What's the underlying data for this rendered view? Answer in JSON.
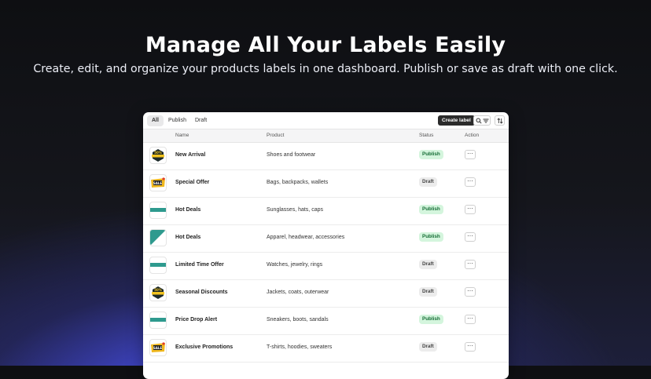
{
  "hero": {
    "title": "Manage All Your Labels Easily",
    "subtitle": "Create, edit, and organize your products labels in one dashboard. Publish or save as draft with one click."
  },
  "tabs": [
    {
      "label": "All",
      "active": true
    },
    {
      "label": "Publish",
      "active": false
    },
    {
      "label": "Draft",
      "active": false
    }
  ],
  "toolbar": {
    "create_label": "Create label",
    "search_filter_icon": "search-filter-icon",
    "sort_icon": "sort-icon"
  },
  "columns": {
    "name": "Name",
    "product": "Product",
    "status": "Status",
    "action": "Action"
  },
  "rows": [
    {
      "thumb": "badge-50-off",
      "name": "New Arrival",
      "product": "Shoes and footwear",
      "status": "Publish"
    },
    {
      "thumb": "sale-tag",
      "name": "Special Offer",
      "product": "Bags, backpacks, wallets",
      "status": "Draft"
    },
    {
      "thumb": "teal-bar",
      "name": "Hot Deals",
      "product": "Sunglasses, hats, caps",
      "status": "Publish"
    },
    {
      "thumb": "teal-corner",
      "name": "Hot Deals",
      "product": "Apparel, headwear, accessories",
      "status": "Publish"
    },
    {
      "thumb": "teal-bar",
      "name": "Limited Time Offer",
      "product": "Watches, jewelry, rings",
      "status": "Draft"
    },
    {
      "thumb": "badge-50-off",
      "name": "Seasonal Discounts",
      "product": "Jackets, coats, outerwear",
      "status": "Draft"
    },
    {
      "thumb": "teal-bar",
      "name": "Price Drop Alert",
      "product": "Sneakers, boots, sandals",
      "status": "Publish"
    },
    {
      "thumb": "sale-tag",
      "name": "Exclusive Promotions",
      "product": "T-shirts, hoodies, sweaters",
      "status": "Draft"
    }
  ],
  "colors": {
    "accent_teal": "#2e9a8e",
    "publish_bg": "#d4f5dd",
    "draft_bg": "#ececec"
  }
}
